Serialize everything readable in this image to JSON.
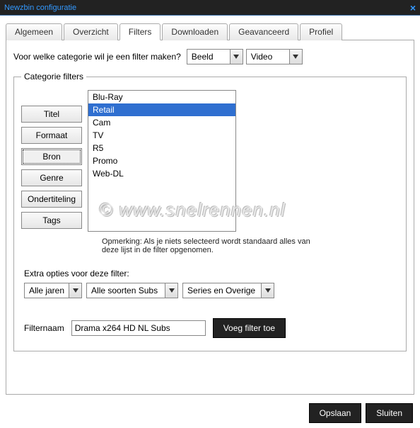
{
  "window": {
    "title": "Newzbin configuratie"
  },
  "tabs": [
    "Algemeen",
    "Overzicht",
    "Filters",
    "Downloaden",
    "Geavanceerd",
    "Profiel"
  ],
  "active_tab": 2,
  "question": "Voor welke categorie wil je een filter maken?",
  "dd_category": "Beeld",
  "dd_subcategory": "Video",
  "groupbox_title": "Categorie filters",
  "side_buttons": [
    "Titel",
    "Formaat",
    "Bron",
    "Genre",
    "Ondertiteling",
    "Tags"
  ],
  "side_buttons_active": 2,
  "list_options": [
    "Blu-Ray",
    "Retail",
    "Cam",
    "TV",
    "R5",
    "Promo",
    "Web-DL"
  ],
  "list_selected": 1,
  "note": "Opmerking: Als je niets selecteerd wordt standaard alles van deze lijst in de filter opgenomen.",
  "extra_label": "Extra opties voor deze filter:",
  "dd_year": "Alle jaren",
  "dd_subs": "Alle soorten Subs",
  "dd_series": "Series en Overige",
  "filtername_label": "Filternaam",
  "filtername_value": "Drama x264 HD NL Subs",
  "add_filter_btn": "Voeg filter toe",
  "save_btn": "Opslaan",
  "close_btn": "Sluiten",
  "watermark": "© www.snelrennen.nl"
}
